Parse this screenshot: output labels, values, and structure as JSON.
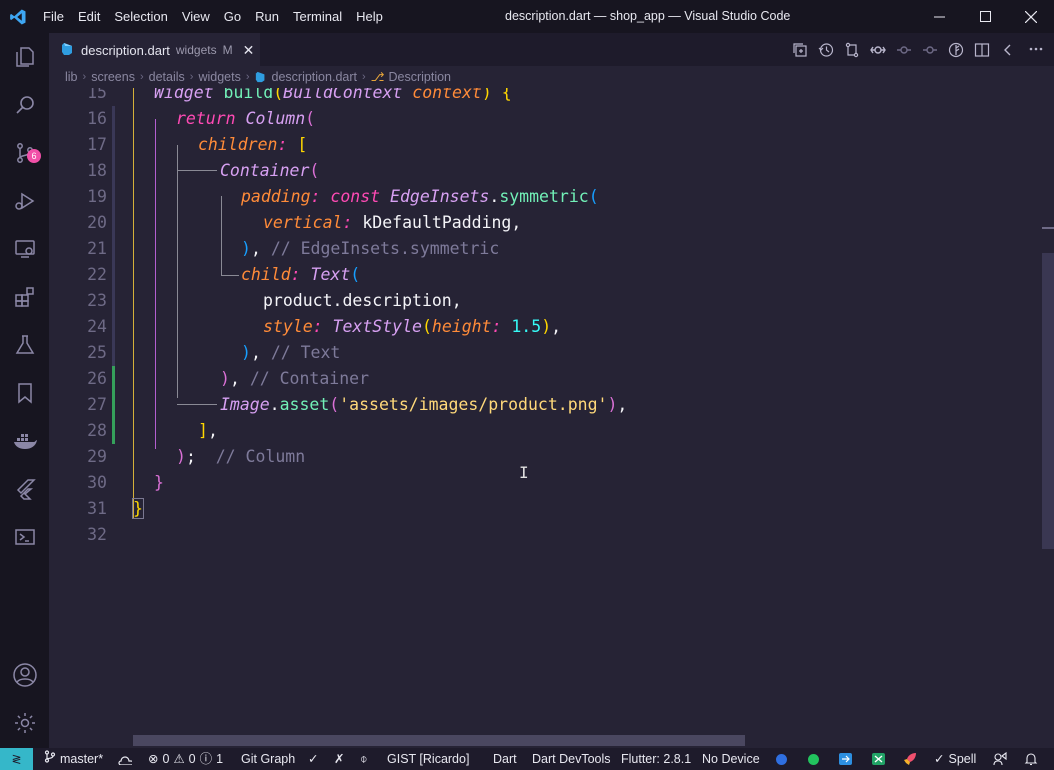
{
  "window": {
    "title": "description.dart — shop_app — Visual Studio Code",
    "menu": [
      "File",
      "Edit",
      "Selection",
      "View",
      "Go",
      "Run",
      "Terminal",
      "Help"
    ]
  },
  "activity_bar": {
    "items": [
      "explorer-icon",
      "search-icon",
      "source-control-icon",
      "run-debug-icon",
      "remote-explorer-icon",
      "extensions-icon",
      "testing-icon",
      "bookmarks-icon",
      "docker-icon",
      "flutter-icon",
      "powershell-icon"
    ],
    "source_control_badge": "6",
    "bottom": [
      "accounts-icon",
      "settings-gear-icon"
    ]
  },
  "tab": {
    "title": "description.dart",
    "description": "widgets",
    "modified": "M"
  },
  "breadcrumbs": [
    "lib",
    "screens",
    "details",
    "widgets",
    "description.dart",
    "Description"
  ],
  "editor": {
    "line_numbers": [
      "15",
      "16",
      "17",
      "18",
      "19",
      "20",
      "21",
      "22",
      "23",
      "24",
      "25",
      "26",
      "27",
      "28",
      "29",
      "30",
      "31",
      "32"
    ]
  },
  "statusbar": {
    "branch": "master*",
    "errors": "0",
    "warnings": "0",
    "info": "1",
    "git_graph": "Git Graph",
    "gist": "GIST [Ricardo]",
    "language": "Dart",
    "devtools": "Dart DevTools",
    "flutter": "Flutter: 2.8.1",
    "device": "No Device",
    "spell": "Spell"
  },
  "colors": {
    "accent_remote": "#35b7c9",
    "badge": "#f150a8",
    "git_added": "#35a05b"
  }
}
